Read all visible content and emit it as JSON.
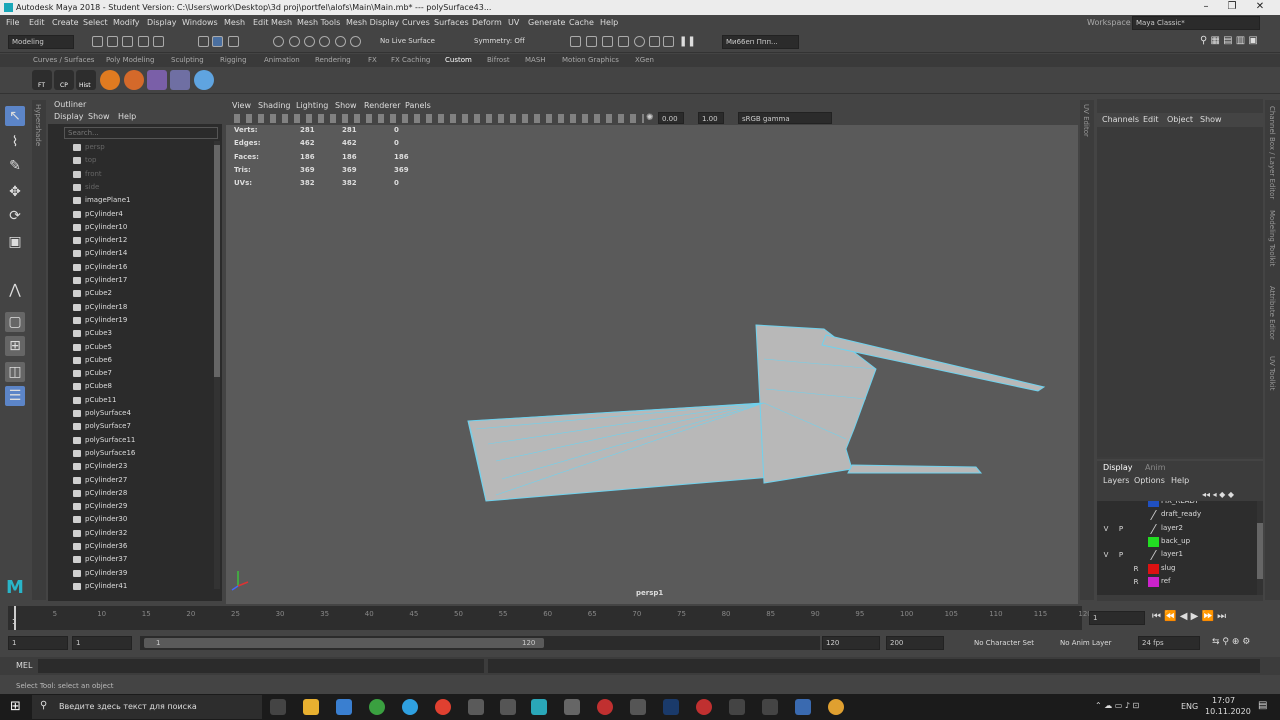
{
  "window": {
    "title": "Autodesk Maya 2018 - Student Version: C:\\Users\\work\\Desktop\\3d proj\\portfel\\alofs\\Main\\Main.mb*   ---   polySurface43...",
    "workspace_label": "Workspace :",
    "workspace_value": "Maya Classic*"
  },
  "menu": [
    "File",
    "Edit",
    "Create",
    "Select",
    "Modify",
    "Display",
    "Windows",
    "Mesh",
    "Edit Mesh",
    "Mesh Tools",
    "Mesh Display",
    "Curves",
    "Surfaces",
    "Deform",
    "UV",
    "Generate",
    "Cache",
    "Help"
  ],
  "toolbar": {
    "mode": "Modeling",
    "live_surface": "No Live Surface",
    "symmetry": "Symmetry: Off",
    "user": "Ми66еп Ппп..."
  },
  "shelf_tabs": [
    "Curves / Surfaces",
    "Poly Modeling",
    "Sculpting",
    "Rigging",
    "Animation",
    "Rendering",
    "FX",
    "FX Caching",
    "Custom",
    "Bifrost",
    "MASH",
    "Motion Graphics",
    "XGen"
  ],
  "shelf_icons": [
    "FT",
    "CP",
    "Hist"
  ],
  "outliner": {
    "title": "Outliner",
    "menu": [
      "Display",
      "Show",
      "Help"
    ],
    "search_placeholder": "Search...",
    "side_label": "Hypershade",
    "items": [
      {
        "n": "persp",
        "dim": true
      },
      {
        "n": "top",
        "dim": true
      },
      {
        "n": "front",
        "dim": true
      },
      {
        "n": "side",
        "dim": true
      },
      {
        "n": "imagePlane1"
      },
      {
        "n": "pCylinder4"
      },
      {
        "n": "pCylinder10"
      },
      {
        "n": "pCylinder12"
      },
      {
        "n": "pCylinder14"
      },
      {
        "n": "pCylinder16"
      },
      {
        "n": "pCylinder17"
      },
      {
        "n": "pCube2"
      },
      {
        "n": "pCylinder18"
      },
      {
        "n": "pCylinder19"
      },
      {
        "n": "pCube3"
      },
      {
        "n": "pCube5"
      },
      {
        "n": "pCube6"
      },
      {
        "n": "pCube7"
      },
      {
        "n": "pCube8"
      },
      {
        "n": "pCube11"
      },
      {
        "n": "polySurface4"
      },
      {
        "n": "polySurface7"
      },
      {
        "n": "polySurface11"
      },
      {
        "n": "polySurface16"
      },
      {
        "n": "pCylinder23"
      },
      {
        "n": "pCylinder27"
      },
      {
        "n": "pCylinder28"
      },
      {
        "n": "pCylinder29"
      },
      {
        "n": "pCylinder30"
      },
      {
        "n": "pCylinder32"
      },
      {
        "n": "pCylinder36"
      },
      {
        "n": "pCylinder37"
      },
      {
        "n": "pCylinder39"
      },
      {
        "n": "pCylinder41"
      }
    ]
  },
  "viewport": {
    "menu": [
      "View",
      "Shading",
      "Lighting",
      "Show",
      "Renderer",
      "Panels"
    ],
    "val1": "0.00",
    "val2": "1.00",
    "colorspace": "sRGB gamma",
    "camera": "persp1",
    "hud": [
      [
        "Verts:",
        "281",
        "281",
        "0"
      ],
      [
        "Edges:",
        "462",
        "462",
        "0"
      ],
      [
        "Faces:",
        "186",
        "186",
        "186"
      ],
      [
        "Tris:",
        "369",
        "369",
        "369"
      ],
      [
        "UVs:",
        "382",
        "382",
        "0"
      ]
    ],
    "uv_editor": "UV Editor"
  },
  "channel": {
    "menu": [
      "Channels",
      "Edit",
      "Object",
      "Show"
    ],
    "side_tabs": [
      "Channel Box / Layer Editor",
      "Modeling Toolkit",
      "Attribute Editor",
      "UV Toolkit"
    ]
  },
  "layers": {
    "tabs": [
      "Display",
      "Anim"
    ],
    "menu": [
      "Layers",
      "Options",
      "Help"
    ],
    "rows": [
      {
        "v": "",
        "p": "",
        "r": "",
        "name": "FIX_READY",
        "color": "#2050c0"
      },
      {
        "v": "",
        "p": "",
        "r": "",
        "name": "draft_ready",
        "color": ""
      },
      {
        "v": "V",
        "p": "P",
        "r": "",
        "name": "layer2",
        "color": ""
      },
      {
        "v": "",
        "p": "",
        "r": "",
        "name": "back_up",
        "color": "#22dd22"
      },
      {
        "v": "V",
        "p": "P",
        "r": "",
        "name": "layer1",
        "color": ""
      },
      {
        "v": "",
        "p": "",
        "r": "R",
        "name": "slug",
        "color": "#dd1111"
      },
      {
        "v": "",
        "p": "",
        "r": "R",
        "name": "ref",
        "color": "#cc22cc"
      }
    ]
  },
  "timeline": {
    "ticks": [
      "1",
      "5",
      "10",
      "15",
      "20",
      "25",
      "30",
      "35",
      "40",
      "45",
      "50",
      "55",
      "60",
      "65",
      "70",
      "75",
      "80",
      "85",
      "90",
      "95",
      "100",
      "105",
      "110",
      "115",
      "120"
    ],
    "current": "1"
  },
  "range": {
    "start": "1",
    "start2": "1",
    "slider_start": "1",
    "slider_end": "120",
    "end": "120",
    "end2": "200",
    "char_set": "No Character Set",
    "anim_layer": "No Anim Layer",
    "fps": "24 fps"
  },
  "mel": {
    "label": "MEL"
  },
  "help_text": "Select Tool: select an object",
  "taskbar": {
    "search": "Введите здесь текст для поиска",
    "lang": "ENG",
    "time": "17:07",
    "date": "10.11.2020"
  }
}
